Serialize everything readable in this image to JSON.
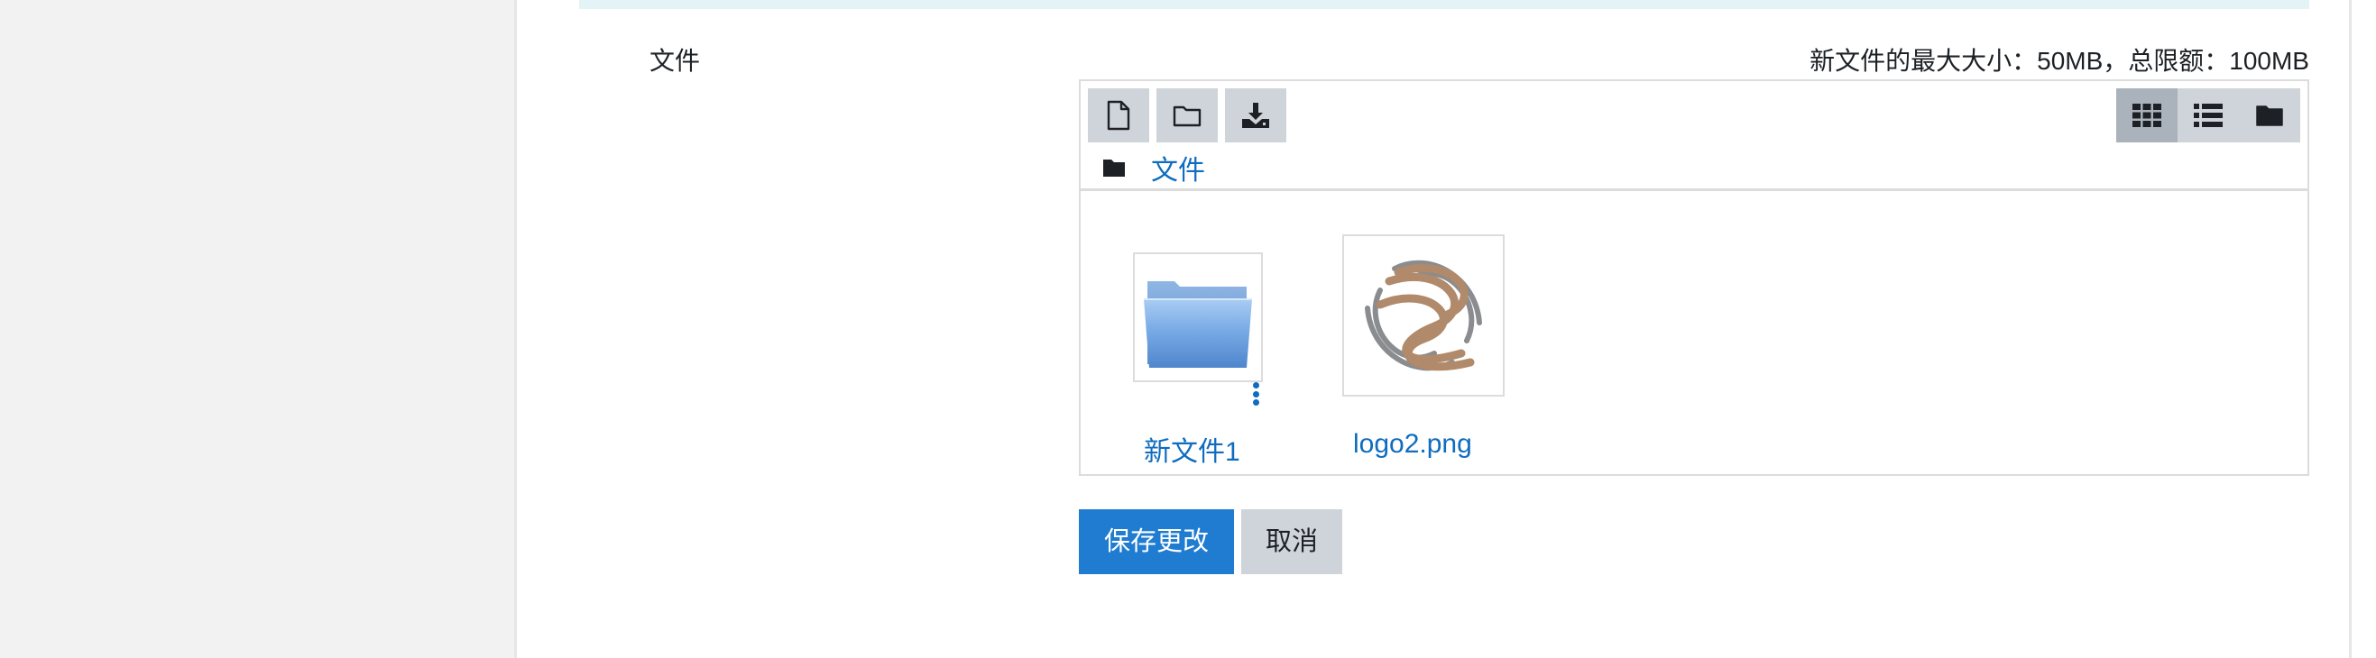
{
  "form": {
    "field_label": "文件",
    "size_limits": "新文件的最大大小：50MB，总限额：100MB"
  },
  "filemanager": {
    "toolbar": {
      "add_file_icon": "file-icon",
      "create_folder_icon": "folder-icon",
      "download_icon": "download-icon",
      "view_modes": [
        {
          "icon": "grid-icon",
          "active": true
        },
        {
          "icon": "list-icon",
          "active": false
        },
        {
          "icon": "folder-tree-icon",
          "active": false
        }
      ]
    },
    "breadcrumb": {
      "icon": "folder-icon",
      "label": "文件"
    },
    "items": [
      {
        "name": "新文件1",
        "type": "folder",
        "icon": "folder-icon"
      },
      {
        "name": "logo2.png",
        "type": "image",
        "icon": "logo-thumbnail"
      }
    ]
  },
  "actions": {
    "save_label": "保存更改",
    "cancel_label": "取消"
  },
  "colors": {
    "link": "#0f6cbf",
    "primary_button": "#1f7cd0",
    "secondary_button": "#ced4da",
    "active_toggle": "#aab3bc",
    "top_strip": "#e4f3f6"
  }
}
